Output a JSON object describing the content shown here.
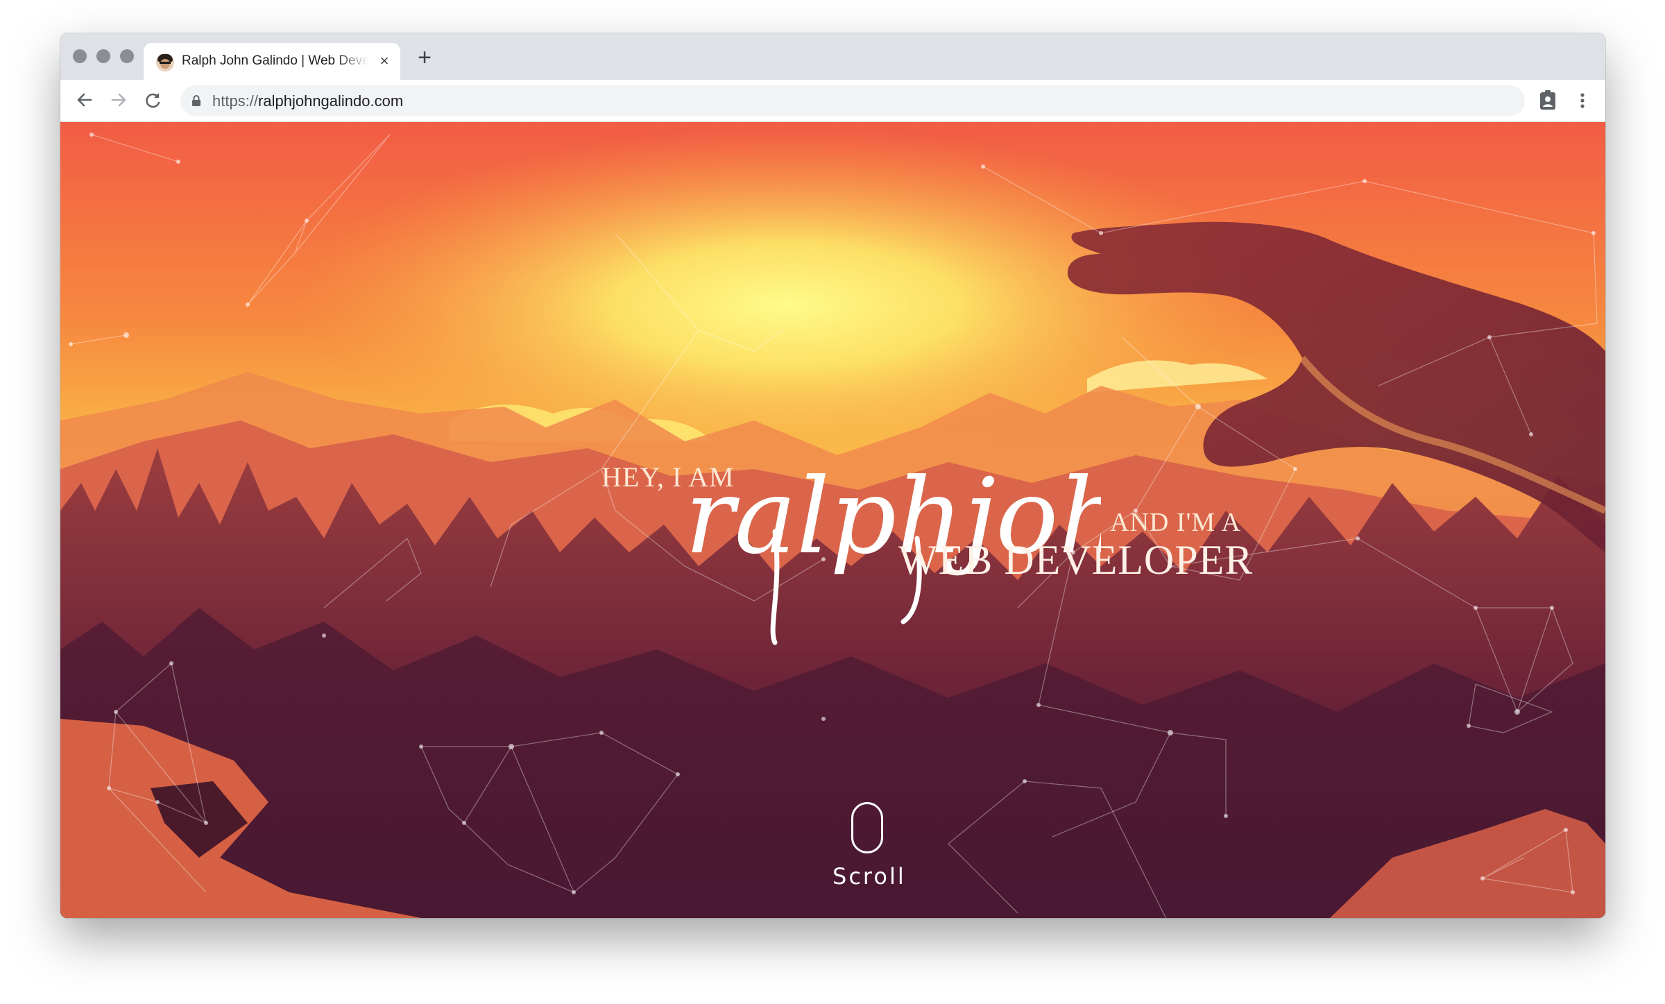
{
  "browser": {
    "tab": {
      "title": "Ralph John Galindo | Web Developer",
      "close_glyph": "×"
    },
    "new_tab_glyph": "+",
    "url": {
      "scheme": "https://",
      "host": "ralphjohngalindo.com"
    },
    "icons": [
      "back-arrow-icon",
      "forward-arrow-icon",
      "reload-icon",
      "lock-icon",
      "profile-badge-icon",
      "kebab-menu-icon"
    ]
  },
  "hero": {
    "greeting": "HEY, I AM",
    "name_script": "ralphjohn",
    "and_im": "AND I'M A",
    "role": "WEB DEVELOPER",
    "scroll_label": "Scroll"
  },
  "colors": {
    "sky_top": "#f26a45",
    "sun": "#fff46a",
    "forest": "#5a1c34",
    "text": "#fde9d4"
  }
}
